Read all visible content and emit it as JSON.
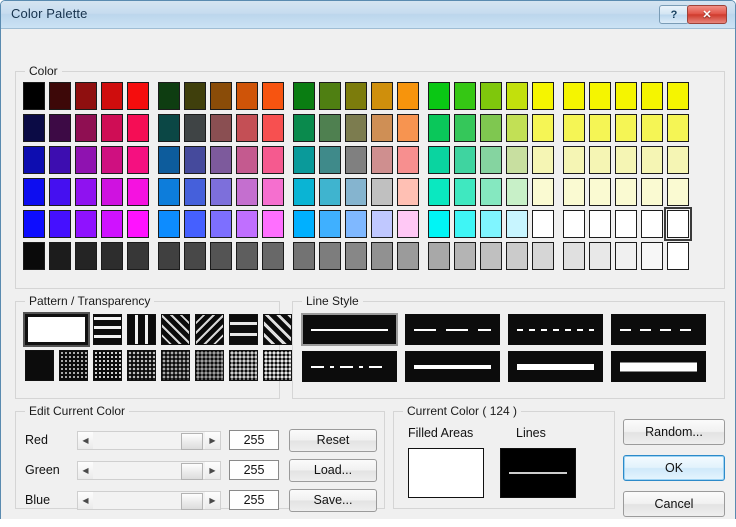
{
  "window": {
    "title": "Color Palette",
    "help_button": "?",
    "close_button": "✕"
  },
  "color_group": {
    "label": "Color",
    "columns": 25,
    "rows": 6,
    "selected_index": 124,
    "swatches": [
      [
        "#000000",
        "#3d0808",
        "#8f0f0f",
        "#cf0d0d",
        "#f50d0d",
        "#0e3d11",
        "#3f3f0c",
        "#8a4c08",
        "#cf5408",
        "#f75410",
        "#0a7d12",
        "#4f7f12",
        "#7c7c0c",
        "#cf8f0c",
        "#f7940c",
        "#0ac714",
        "#35c714",
        "#7fc70c",
        "#c2e00c",
        "#f5f500"
      ],
      [
        "#0b0b45",
        "#3d0a45",
        "#8f0f52",
        "#cf0d55",
        "#f50d55",
        "#0b4745",
        "#3f4445",
        "#8a4f52",
        "#c44f55",
        "#f75050",
        "#0a8a4d",
        "#4f8050",
        "#7c7c4f",
        "#cf8f55",
        "#f79450",
        "#0ac75a",
        "#35c75a",
        "#7fc750",
        "#c2e055",
        "#f5f555"
      ],
      [
        "#0d0db0",
        "#3d0db0",
        "#8f12b0",
        "#cf1080",
        "#f51080",
        "#0d5c9c",
        "#454a9c",
        "#7d5a9c",
        "#c45a8f",
        "#f55a8f",
        "#0a9a9a",
        "#3f8a8a",
        "#808080",
        "#cf8f8f",
        "#f78f8f",
        "#0ad4a0",
        "#3fd4a0",
        "#85d4a0",
        "#c8dfa0",
        "#f5f5b4"
      ],
      [
        "#0d0df0",
        "#4510f0",
        "#8f12f0",
        "#cf12e0",
        "#f512e0",
        "#0d7ddb",
        "#4560db",
        "#7d6fdb",
        "#c46fcf",
        "#f56fcf",
        "#0ab4d4",
        "#3fb4cf",
        "#85b4cf",
        "#c0c0c0",
        "#ffc0b4",
        "#0ae8c0",
        "#3fe8c0",
        "#85e8c0",
        "#c8f0c8",
        "#fafad2"
      ],
      [
        "#0d0dff",
        "#4510ff",
        "#8f12ff",
        "#cf12ff",
        "#ff12ff",
        "#0d8cff",
        "#4560ff",
        "#7d6fff",
        "#c06fff",
        "#ff6fff",
        "#00b0ff",
        "#3fb0ff",
        "#7fb8ff",
        "#c0c8ff",
        "#ffc8f5",
        "#00f5f5",
        "#3ff5f5",
        "#7ff5ff",
        "#c8f5ff",
        "#ffffff"
      ],
      [
        "#0a0a0a",
        "#1c1c1c",
        "#242424",
        "#2d2d2d",
        "#373737",
        "#404040",
        "#484848",
        "#545454",
        "#5e5e5e",
        "#686868",
        "#737373",
        "#7d7d7d",
        "#878787",
        "#919191",
        "#9b9b9b",
        "#a8a8a8",
        "#b4b4b4",
        "#c0c0c0",
        "#cbcbcb",
        "#d6d6d6",
        "#e0e0e0",
        "#e8e8e8",
        "#f0f0f0",
        "#f7f7f7",
        "#ffffff"
      ]
    ]
  },
  "pattern_group": {
    "label": "Pattern / Transparency",
    "selected_index": 0,
    "row1": [
      "no-pattern",
      "horizontal-lines",
      "vertical-lines",
      "diagonal-lines",
      "back-diagonal-lines",
      "cross-hatch",
      "diagonal-cross-hatch"
    ],
    "row2": [
      "solid-fill",
      "dither-6",
      "dither-12",
      "dither-25",
      "dither-37",
      "dither-50",
      "dither-62",
      "dither-75"
    ]
  },
  "line_group": {
    "label": "Line Style",
    "selected_index": 0,
    "styles": [
      {
        "name": "solid-thin",
        "pattern": "solid",
        "thickness": 2
      },
      {
        "name": "long-dash",
        "pattern": "dash-long",
        "thickness": 2
      },
      {
        "name": "short-dash",
        "pattern": "dash-short",
        "thickness": 2
      },
      {
        "name": "medium-dash",
        "pattern": "dash-medium",
        "thickness": 2
      },
      {
        "name": "dash-dot",
        "pattern": "dash-dot",
        "thickness": 2
      },
      {
        "name": "solid-medium",
        "pattern": "solid",
        "thickness": 4
      },
      {
        "name": "solid-thick",
        "pattern": "solid",
        "thickness": 6
      },
      {
        "name": "solid-extra-thick",
        "pattern": "solid",
        "thickness": 9
      }
    ]
  },
  "edit_group": {
    "label": "Edit Current Color",
    "channels": [
      {
        "name": "Red",
        "value": "255",
        "percent": 100
      },
      {
        "name": "Green",
        "value": "255",
        "percent": 100
      },
      {
        "name": "Blue",
        "value": "255",
        "percent": 100
      }
    ],
    "buttons": [
      "Reset",
      "Load...",
      "Save..."
    ],
    "arrow_left": "◀",
    "arrow_right": "▶"
  },
  "current_group": {
    "label": "Current Color  ( 124 )",
    "filled_areas_label": "Filled Areas",
    "lines_label": "Lines",
    "filled_areas_color": "#ffffff",
    "lines_background": "#000000",
    "lines_color": "#cccccc"
  },
  "action_buttons": {
    "random": "Random...",
    "ok": "OK",
    "cancel": "Cancel"
  }
}
